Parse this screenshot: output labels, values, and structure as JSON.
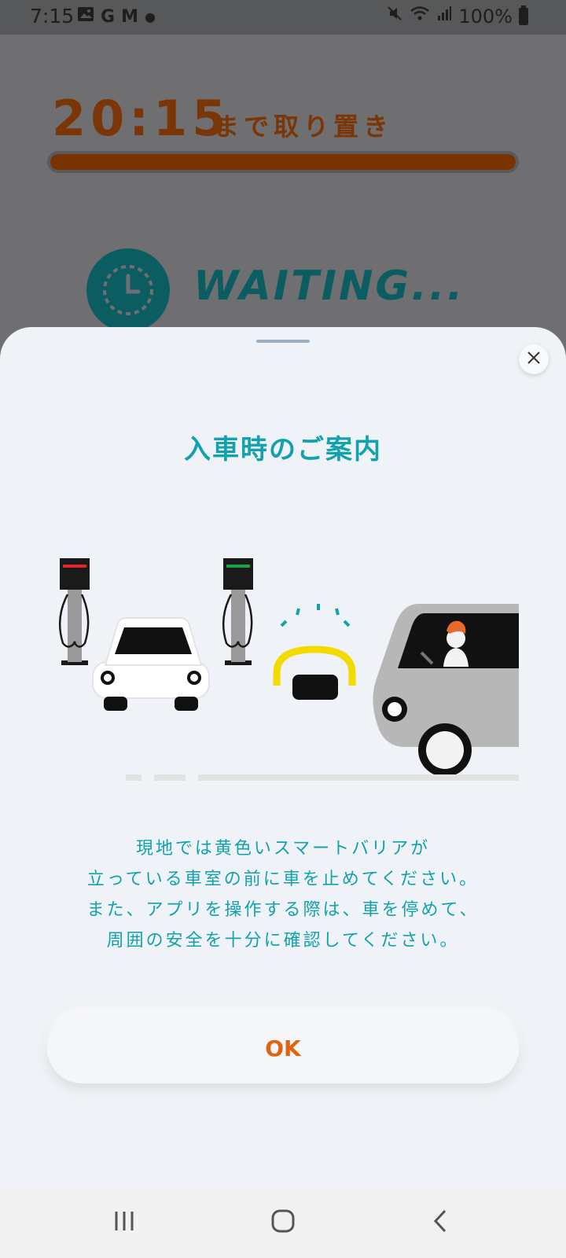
{
  "status_bar": {
    "time": "7:15",
    "battery": "100%",
    "icons": [
      "gallery-icon",
      "google-icon",
      "gmail-icon",
      "dot-icon",
      "mute-icon",
      "wifi-icon",
      "signal-icon",
      "battery-icon"
    ]
  },
  "background": {
    "reserve_time": "20:15",
    "reserve_suffix": "まで取り置き",
    "progress": 1.0,
    "status_text": "WAITING...",
    "accent": "#7b3607",
    "waiting_color": "#0c5d62"
  },
  "sheet": {
    "title": "入車時のご案内",
    "message_lines": [
      "現地では黄色いスマートバリアが",
      "立っている車室の前に車を止めてください。",
      "また、アプリを操作する際は、車を停めて、",
      "周囲の安全を十分に確認してください。"
    ],
    "ok_label": "OK",
    "title_color": "#13a2ad",
    "ok_color": "#e2630e"
  },
  "nav_bar": {
    "buttons": [
      "recent-apps",
      "home",
      "back"
    ]
  }
}
